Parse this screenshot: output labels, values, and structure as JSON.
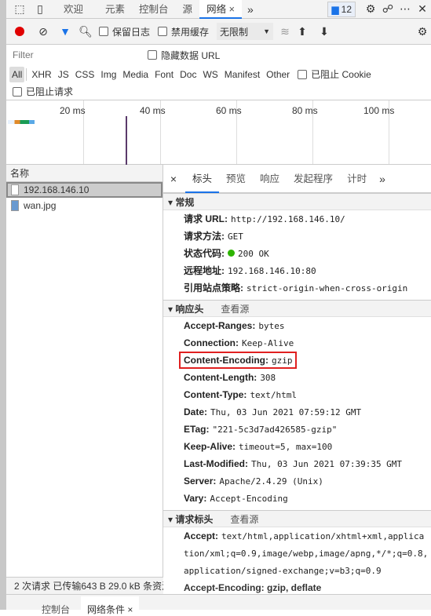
{
  "top_tabs": [
    "欢迎",
    "元素",
    "控制台",
    "源",
    "网络"
  ],
  "issues_count": "12",
  "toolbar": {
    "preserve_log": "保留日志",
    "disable_cache": "禁用缓存",
    "throttle": "无限制"
  },
  "filter": {
    "placeholder": "Filter",
    "hide_data_urls": "隐藏数据 URL"
  },
  "types": [
    "All",
    "XHR",
    "JS",
    "CSS",
    "Img",
    "Media",
    "Font",
    "Doc",
    "WS",
    "Manifest",
    "Other"
  ],
  "blocked_cookies": "已阻止 Cookie",
  "blocked_requests": "已阻止请求",
  "timeline_ticks": [
    "20 ms",
    "40 ms",
    "60 ms",
    "80 ms",
    "100 ms"
  ],
  "list": {
    "header": "名称",
    "items": [
      "192.168.146.10",
      "wan.jpg"
    ]
  },
  "detail_tabs": [
    "标头",
    "预览",
    "响应",
    "发起程序",
    "计时"
  ],
  "general": {
    "title": "常规",
    "rows": [
      {
        "k": "请求 URL:",
        "v": "http://192.168.146.10/"
      },
      {
        "k": "请求方法:",
        "v": "GET"
      },
      {
        "k": "状态代码:",
        "v": "200 OK"
      },
      {
        "k": "远程地址:",
        "v": "192.168.146.10:80"
      },
      {
        "k": "引用站点策略:",
        "v": "strict-origin-when-cross-origin"
      }
    ]
  },
  "response_headers": {
    "title": "响应头",
    "view_source": "查看源",
    "rows": [
      {
        "k": "Accept-Ranges:",
        "v": "bytes"
      },
      {
        "k": "Connection:",
        "v": "Keep-Alive"
      },
      {
        "k": "Content-Encoding:",
        "v": "gzip"
      },
      {
        "k": "Content-Length:",
        "v": "308"
      },
      {
        "k": "Content-Type:",
        "v": "text/html"
      },
      {
        "k": "Date:",
        "v": "Thu, 03 Jun 2021 07:59:12 GMT"
      },
      {
        "k": "ETag:",
        "v": "\"221-5c3d7ad426585-gzip\""
      },
      {
        "k": "Keep-Alive:",
        "v": "timeout=5, max=100"
      },
      {
        "k": "Last-Modified:",
        "v": "Thu, 03 Jun 2021 07:39:35 GMT"
      },
      {
        "k": "Server:",
        "v": "Apache/2.4.29 (Unix)"
      },
      {
        "k": "Vary:",
        "v": "Accept-Encoding"
      }
    ]
  },
  "request_headers": {
    "title": "请求标头",
    "view_source": "查看源",
    "accept_key": "Accept:",
    "accept_lines": [
      "text/html,application/xhtml+xml,applica",
      "tion/xml;q=0.9,image/webp,image/apng,*/*;q=0.8,",
      "application/signed-exchange;v=b3;q=0.9"
    ],
    "next_row": "Accept-Encoding: gzip, deflate"
  },
  "status_bar": "2 次请求  已传输643 B  29.0 kB 条资源",
  "drawer_tabs": [
    "控制台",
    "网络条件"
  ],
  "colors": {
    "accent": "#1a73e8",
    "record": "#e00000",
    "highlight_box": "#e02020",
    "status_ok": "#2db300"
  }
}
